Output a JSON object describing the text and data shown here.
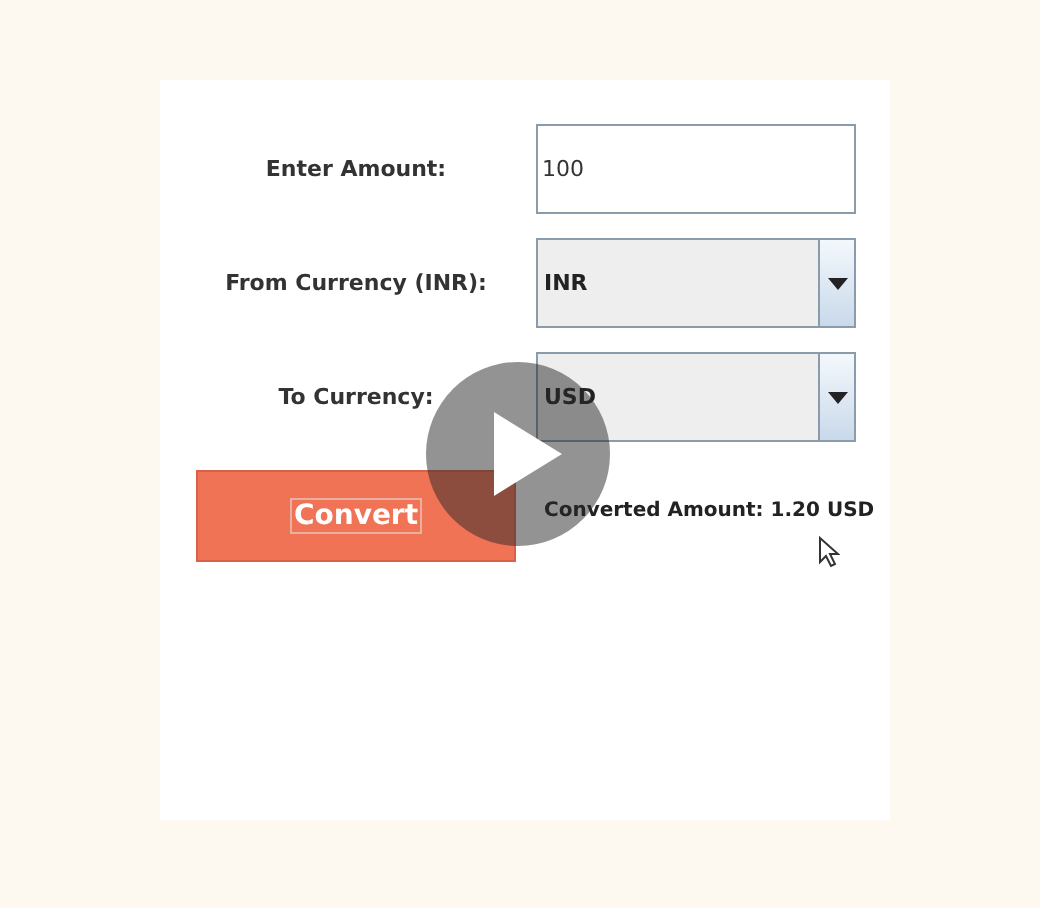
{
  "form": {
    "rows": [
      {
        "kind": "text",
        "label": "Enter Amount:",
        "value": "100"
      },
      {
        "kind": "combo",
        "label": "From Currency (INR):",
        "value": "INR"
      },
      {
        "kind": "combo",
        "label": "To Currency:",
        "value": "USD"
      }
    ]
  },
  "convert_button": {
    "label": "Convert"
  },
  "result": "Converted Amount: 1.20 USD"
}
